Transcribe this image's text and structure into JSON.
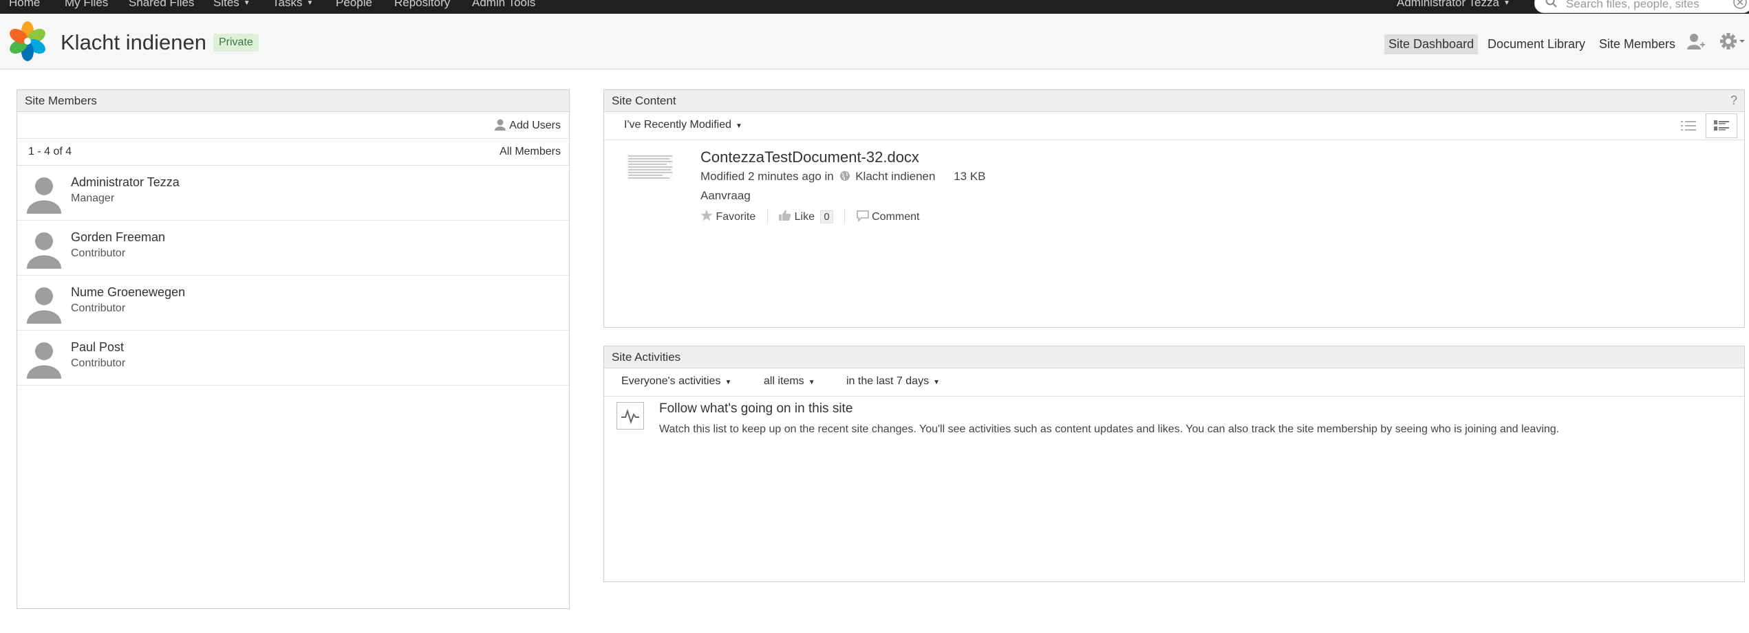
{
  "topnav": {
    "items": [
      {
        "label": "Home",
        "caret": false
      },
      {
        "label": "My Files",
        "caret": false
      },
      {
        "label": "Shared Files",
        "caret": false
      },
      {
        "label": "Sites",
        "caret": true
      },
      {
        "label": "Tasks",
        "caret": true
      },
      {
        "label": "People",
        "caret": false
      },
      {
        "label": "Repository",
        "caret": false
      },
      {
        "label": "Admin Tools",
        "caret": false
      }
    ],
    "user_menu": "Administrator Tezza",
    "search_placeholder": "Search files, people, sites"
  },
  "header": {
    "site_title": "Klacht indienen",
    "visibility_badge": "Private",
    "links": [
      "Site Dashboard",
      "Document Library",
      "Site Members"
    ],
    "active_link": "Site Dashboard"
  },
  "site_members": {
    "title": "Site Members",
    "add_users": "Add Users",
    "count": "1 - 4 of 4",
    "all_members": "All Members",
    "members": [
      {
        "name": "Administrator Tezza",
        "role": "Manager"
      },
      {
        "name": "Gorden Freeman",
        "role": "Contributor"
      },
      {
        "name": "Nume Groenewegen",
        "role": "Contributor"
      },
      {
        "name": "Paul Post",
        "role": "Contributor"
      }
    ]
  },
  "site_content": {
    "title": "Site Content",
    "help": "?",
    "filter": "I've Recently Modified",
    "document": {
      "name": "ContezzaTestDocument-32.docx",
      "modified": "Modified 2 minutes ago in",
      "site": "Klacht indienen",
      "size": "13 KB",
      "description": "Aanvraag",
      "favorite": "Favorite",
      "like": "Like",
      "like_count": "0",
      "comment": "Comment"
    }
  },
  "site_activities": {
    "title": "Site Activities",
    "filter_who": "Everyone's activities",
    "filter_what": "all items",
    "filter_when": "in the last 7 days",
    "empty_title": "Follow what's going on in this site",
    "empty_text": "Watch this list to keep up on the recent site changes. You'll see activities such as content updates and likes. You can also track the site membership by seeing who is joining and leaving."
  }
}
